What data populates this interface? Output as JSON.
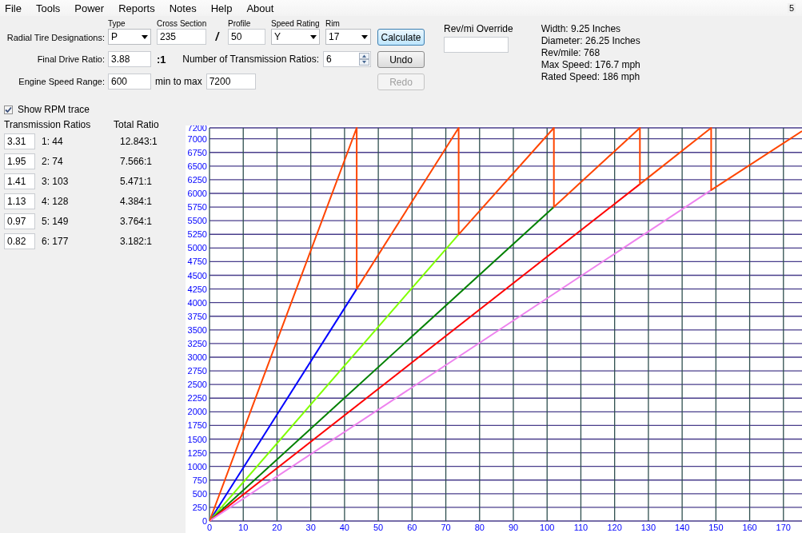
{
  "menu": [
    "File",
    "Tools",
    "Power",
    "Reports",
    "Notes",
    "Help",
    "About"
  ],
  "menu_badge": "5",
  "tire": {
    "label": "Radial Tire Designations:",
    "fields": [
      {
        "kind": "select",
        "label": "Type",
        "value": "P"
      },
      {
        "kind": "input",
        "label": "Cross Section",
        "value": "235"
      },
      {
        "kind": "separator",
        "text": "/"
      },
      {
        "kind": "input",
        "label": "Profile",
        "value": "50"
      },
      {
        "kind": "select",
        "label": "Speed Rating",
        "value": "Y"
      },
      {
        "kind": "select",
        "label": "Rim",
        "value": "17"
      }
    ]
  },
  "final_drive": {
    "label": "Final Drive Ratio:",
    "value": "3.88",
    "suffix": ":1"
  },
  "num_ratios": {
    "label": "Number of Transmission Ratios:",
    "value": "6"
  },
  "engine_speed": {
    "label": "Engine Speed Range:",
    "min": "600",
    "between": "min to max",
    "max": "7200"
  },
  "buttons": [
    {
      "label": "Calculate",
      "disabled": false,
      "focused": true
    },
    {
      "label": "Undo",
      "disabled": false,
      "focused": false
    },
    {
      "label": "Redo",
      "disabled": true,
      "focused": false
    }
  ],
  "override": {
    "label": "Rev/mi Override"
  },
  "info": [
    "Width: 9.25 Inches",
    "Diameter: 26.25 Inches",
    "Rev/mile: 768",
    "Max Speed: 176.7 mph",
    "Rated Speed: 186 mph"
  ],
  "show_rpm_trace": {
    "label": "Show RPM trace",
    "checked": true
  },
  "ratios": {
    "headers": [
      "Transmission Ratios",
      "Total Ratio"
    ],
    "rows": [
      {
        "ratio": "3.31",
        "gear": "1: 44",
        "total": "12.843:1"
      },
      {
        "ratio": "1.95",
        "gear": "2: 74",
        "total": "7.566:1"
      },
      {
        "ratio": "1.41",
        "gear": "3: 103",
        "total": "5.471:1"
      },
      {
        "ratio": "1.13",
        "gear": "4: 128",
        "total": "4.384:1"
      },
      {
        "ratio": "0.97",
        "gear": "5: 149",
        "total": "3.764:1"
      },
      {
        "ratio": "0.82",
        "gear": "6: 177",
        "total": "3.182:1"
      }
    ]
  },
  "chart_data": {
    "type": "line",
    "grid": true,
    "xlim": [
      0,
      175.5
    ],
    "ylim": [
      0,
      7200
    ],
    "xticks": [
      0,
      10,
      20,
      30,
      40,
      50,
      60,
      70,
      80,
      90,
      100,
      110,
      120,
      130,
      140,
      150,
      160,
      170
    ],
    "yticks": [
      0,
      250,
      500,
      750,
      1000,
      1250,
      1500,
      1750,
      2000,
      2250,
      2500,
      2750,
      3000,
      3250,
      3500,
      3750,
      4000,
      4250,
      4500,
      4750,
      5000,
      5250,
      5500,
      5750,
      6000,
      6250,
      6500,
      6750,
      7000,
      7200
    ],
    "series": [
      {
        "color": "#0000ff",
        "x": [
          0,
          43.6
        ],
        "values": [
          0,
          4250
        ]
      },
      {
        "color": "#7fff00",
        "x": [
          0,
          73.8
        ],
        "values": [
          0,
          5250
        ]
      },
      {
        "color": "#008000",
        "x": [
          0,
          102
        ],
        "values": [
          0,
          5750
        ]
      },
      {
        "color": "#ff0000",
        "x": [
          0,
          127.5
        ],
        "values": [
          0,
          6170
        ]
      },
      {
        "color": "#ee82ee",
        "x": [
          0,
          148.6
        ],
        "values": [
          0,
          6060
        ]
      },
      {
        "color": "#ff4500",
        "x": [
          0,
          43.6,
          43.6,
          73.8,
          73.8,
          102,
          102,
          127.5,
          127.5,
          148.6,
          148.6,
          175.5
        ],
        "values": [
          0,
          7200,
          4250,
          7200,
          5250,
          7200,
          5750,
          7200,
          6170,
          7200,
          6060,
          7140
        ]
      }
    ]
  }
}
